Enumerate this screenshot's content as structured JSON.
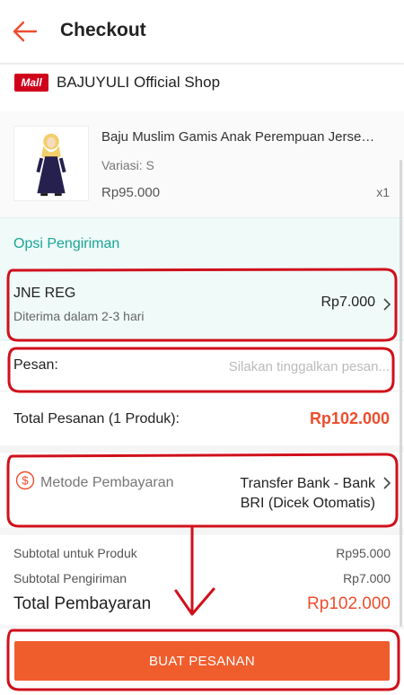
{
  "header": {
    "title": "Checkout",
    "back_icon": "back-arrow-icon"
  },
  "shop": {
    "badge": "Mall",
    "name": "BAJUYULI Official Shop"
  },
  "product": {
    "name": "Baju Muslim Gamis Anak Perempuan Jerse…",
    "variant": "Variasi: S",
    "price": "Rp95.000",
    "qty": "x1"
  },
  "shipping": {
    "header": "Opsi Pengiriman",
    "courier": "JNE REG",
    "eta": "Diterima dalam 2-3 hari",
    "price": "Rp7.000"
  },
  "message": {
    "label": "Pesan:",
    "placeholder": "Silakan tinggalkan pesan...",
    "value": ""
  },
  "order_total": {
    "label": "Total Pesanan (1 Produk):",
    "value": "Rp102.000"
  },
  "payment": {
    "label": "Metode Pembayaran",
    "value_line1": "Transfer Bank - Bank",
    "value_line2": "BRI (Dicek Otomatis)",
    "icon": "dollar-circle-icon"
  },
  "summary": {
    "subtotal_product_label": "Subtotal untuk Produk",
    "subtotal_product_value": "Rp95.000",
    "subtotal_shipping_label": "Subtotal Pengiriman",
    "subtotal_shipping_value": "Rp7.000",
    "grand_label": "Total Pembayaran",
    "grand_value": "Rp102.000"
  },
  "footer": {
    "button_label": "BUAT PESANAN"
  },
  "colors": {
    "accent": "#ee4d2d",
    "teal": "#1aa595",
    "mall": "#d0011b",
    "annotation": "#d0101b"
  }
}
